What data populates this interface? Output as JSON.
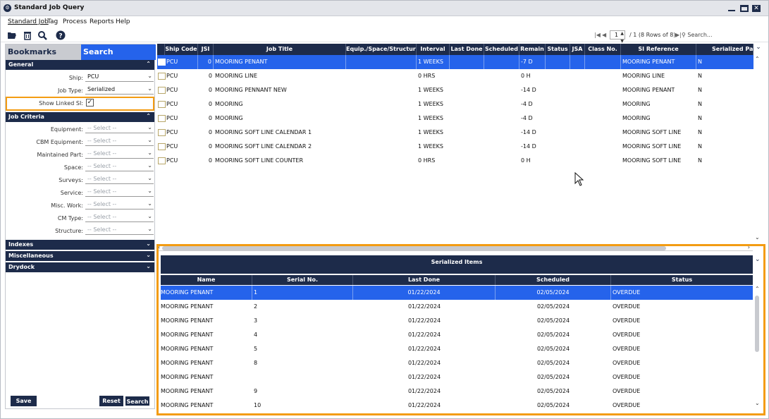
{
  "window": {
    "title": "Standard Job Query"
  },
  "menu": [
    "Standard Job",
    "Tag",
    "Process",
    "Reports",
    "Help"
  ],
  "pager": {
    "page": "1",
    "summary": "/  1 (8 Rows of 8)",
    "search_placeholder": "Search..."
  },
  "left_panel": {
    "tabs": {
      "bookmarks": "Bookmarks",
      "search": "Search"
    },
    "general": {
      "title": "General",
      "ship_label": "Ship:",
      "ship_value": "PCU",
      "job_type_label": "Job Type:",
      "job_type_value": "Serialized",
      "show_linked_label": "Show Linked SI:",
      "show_linked_checked": true
    },
    "job_criteria": {
      "title": "Job Criteria",
      "fields": [
        {
          "label": "Equipment:",
          "value": "-- Select --"
        },
        {
          "label": "CBM Equipment:",
          "value": "-- Select --"
        },
        {
          "label": "Maintained Part:",
          "value": "-- Select --"
        },
        {
          "label": "Space:",
          "value": "-- Select --"
        },
        {
          "label": "Surveys:",
          "value": "-- Select --"
        },
        {
          "label": "Service:",
          "value": "-- Select --"
        },
        {
          "label": "Misc. Work:",
          "value": "-- Select --"
        },
        {
          "label": "CM Type:",
          "value": "-- Select --"
        },
        {
          "label": "Structure:",
          "value": "-- Select --"
        }
      ]
    },
    "collapsed_sections": [
      "Indexes",
      "Miscellaneous",
      "Drydock"
    ],
    "buttons": {
      "save": "Save",
      "reset": "Reset",
      "search": "Search"
    }
  },
  "jobs_grid": {
    "columns": [
      "Ship Code",
      "JSI",
      "Job Title",
      "Equip./Space/Structure",
      "Interval",
      "Last Done",
      "Scheduled",
      "Remain",
      "Status",
      "JSA",
      "Class No.",
      "SI Reference",
      "Serialized Part"
    ],
    "rows": [
      {
        "ship": "PCU",
        "jsi": "0",
        "title": "MOORING PENANT",
        "interval": "1 WEEKS",
        "remain": "-7 D",
        "si_ref": "MOORING PENANT",
        "serialized": "N"
      },
      {
        "ship": "PCU",
        "jsi": "0",
        "title": "MOORING LINE",
        "interval": "0 HRS",
        "remain": "0 H",
        "si_ref": "MOORING LINE",
        "serialized": "N"
      },
      {
        "ship": "PCU",
        "jsi": "0",
        "title": "MOORING PENNANT NEW",
        "interval": "1 WEEKS",
        "remain": "-14 D",
        "si_ref": "MOORING PENANT",
        "serialized": "N"
      },
      {
        "ship": "PCU",
        "jsi": "0",
        "title": "MOORING",
        "interval": "1 WEEKS",
        "remain": "-4 D",
        "si_ref": "MOORING",
        "serialized": "N"
      },
      {
        "ship": "PCU",
        "jsi": "0",
        "title": "MOORING",
        "interval": "1 WEEKS",
        "remain": "-4 D",
        "si_ref": "MOORING",
        "serialized": "N"
      },
      {
        "ship": "PCU",
        "jsi": "0",
        "title": "MOORING SOFT LINE CALENDAR 1",
        "interval": "1 WEEKS",
        "remain": "-14 D",
        "si_ref": "MOORING SOFT LINE",
        "serialized": "N"
      },
      {
        "ship": "PCU",
        "jsi": "0",
        "title": "MOORING SOFT LINE CALENDAR 2",
        "interval": "1 WEEKS",
        "remain": "-14 D",
        "si_ref": "MOORING SOFT LINE",
        "serialized": "N"
      },
      {
        "ship": "PCU",
        "jsi": "0",
        "title": "MOORING SOFT LINE COUNTER",
        "interval": "0 HRS",
        "remain": "0 H",
        "si_ref": "MOORING SOFT LINE",
        "serialized": "N"
      }
    ]
  },
  "serialized_items": {
    "title": "Serialized Items",
    "columns": [
      "Name",
      "Serial No.",
      "Last Done",
      "Scheduled",
      "Status"
    ],
    "rows": [
      {
        "name": "MOORING PENANT",
        "serial": "1",
        "last_done": "01/22/2024",
        "scheduled": "02/05/2024",
        "status": "OVERDUE"
      },
      {
        "name": "MOORING PENANT",
        "serial": "2",
        "last_done": "01/22/2024",
        "scheduled": "02/05/2024",
        "status": "OVERDUE"
      },
      {
        "name": "MOORING PENANT",
        "serial": "3",
        "last_done": "01/22/2024",
        "scheduled": "02/05/2024",
        "status": "OVERDUE"
      },
      {
        "name": "MOORING PENANT",
        "serial": "4",
        "last_done": "01/22/2024",
        "scheduled": "02/05/2024",
        "status": "OVERDUE"
      },
      {
        "name": "MOORING PENANT",
        "serial": "5",
        "last_done": "01/22/2024",
        "scheduled": "02/05/2024",
        "status": "OVERDUE"
      },
      {
        "name": "MOORING PENANT",
        "serial": "8",
        "last_done": "01/22/2024",
        "scheduled": "02/05/2024",
        "status": "OVERDUE"
      },
      {
        "name": "MOORING PENANT",
        "serial": "",
        "last_done": "01/22/2024",
        "scheduled": "02/05/2024",
        "status": "OVERDUE"
      },
      {
        "name": "MOORING PENANT",
        "serial": "9",
        "last_done": "01/22/2024",
        "scheduled": "02/05/2024",
        "status": "OVERDUE"
      },
      {
        "name": "MOORING PENANT",
        "serial": "10",
        "last_done": "01/22/2024",
        "scheduled": "02/05/2024",
        "status": "OVERDUE"
      }
    ]
  },
  "colors": {
    "navy": "#1d2b4a",
    "select_blue": "#2563eb",
    "highlight_orange": "#f39c12"
  }
}
